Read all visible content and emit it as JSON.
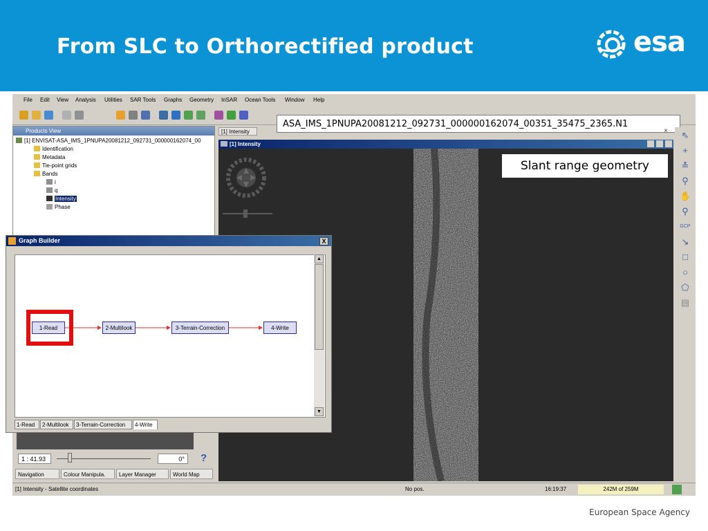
{
  "slide": {
    "title": "From SLC to Orthorectified product",
    "logo_text": "esa",
    "footer": "European Space Agency"
  },
  "colors": {
    "header_blue": "#0b93d6",
    "highlight_red": "#e01010",
    "titlebar": "#0a246a"
  },
  "menu": [
    "File",
    "Edit",
    "View",
    "Analysis",
    "Utilities",
    "SAR Tools",
    "Graphs",
    "Geometry",
    "InSAR",
    "Ocean Tools",
    "Window",
    "Help"
  ],
  "toolbar": {
    "icons": [
      "open-product-icon",
      "save-icon",
      "undo-icon",
      "close-icon",
      "properties-icon",
      "band-maths-icon",
      "layers-icon",
      "graph-icon",
      "image-view-icon",
      "world-map-icon",
      "wind-icon",
      "stack-icon",
      "edit-icon",
      "tools-icon",
      "insar-icon"
    ],
    "filename": "ASA_IMS_1PNUPA20081212_092731_000000162074_00351_35475_2365.N1"
  },
  "products_view": {
    "title": "Products View",
    "tree": [
      {
        "label": "[1] ENVISAT-ASA_IMS_1PNUPA20081212_092731_000000162074_00",
        "level": 0
      },
      {
        "label": "Identification",
        "level": 1
      },
      {
        "label": "Metadata",
        "level": 1
      },
      {
        "label": "Tie-point grids",
        "level": 1
      },
      {
        "label": "Bands",
        "level": 1
      },
      {
        "label": "i",
        "level": 2
      },
      {
        "label": "q",
        "level": 2
      },
      {
        "label": "Intensity",
        "level": 2,
        "selected": true
      },
      {
        "label": "Phase",
        "level": 2
      }
    ]
  },
  "image_view": {
    "tab_label": "[1] Intensity",
    "window_title": "[1] Intensity",
    "annotation": "Slant range geometry"
  },
  "right_tools": [
    "select-icon",
    "crosshair-icon",
    "range-finder-icon",
    "zoom-icon",
    "pan-icon",
    "pin-icon",
    "gcp-icon",
    "line-icon",
    "rectangle-icon",
    "ellipse-icon",
    "polygon-icon",
    "magic-wand-icon"
  ],
  "graph_builder": {
    "title": "Graph Builder",
    "close_label": "X",
    "nodes": [
      "1-Read",
      "2-Multilook",
      "3-Terrain-Correction",
      "4-Write"
    ],
    "tabs": [
      "1-Read",
      "2-Multilook",
      "3-Terrain-Correction",
      "4-Write"
    ],
    "highlighted_node": "1-Read"
  },
  "navigation": {
    "zoom_ratio": "1 : 41.93",
    "rotation": "0°",
    "help_label": "?",
    "tabs": [
      "Navigation",
      "Colour Manipula.",
      "Layer Manager",
      "World Map"
    ]
  },
  "status": {
    "message": "[1] Intensity - Satellite coordinates",
    "position": "No pos.",
    "time": "16:19:37",
    "memory": "242M of 259M"
  }
}
